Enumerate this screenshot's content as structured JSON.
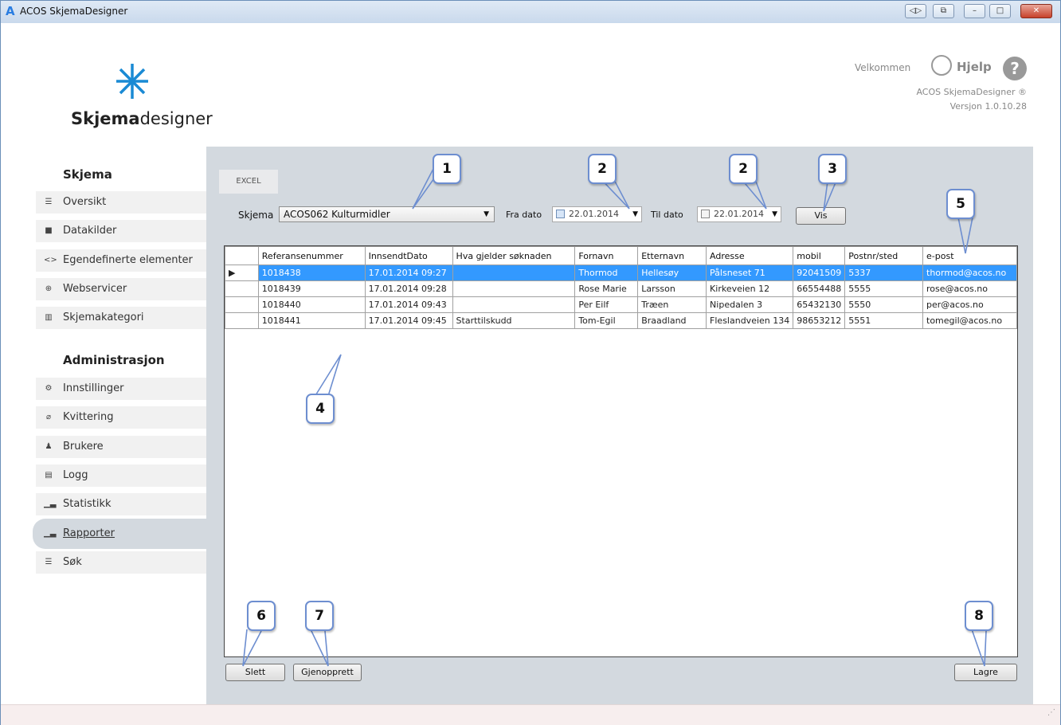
{
  "window": {
    "title": "ACOS SkjemaDesigner",
    "buttons": [
      "◁▷",
      "⧉",
      "–",
      "□",
      "✕"
    ]
  },
  "header": {
    "logo_bold": "Skjema",
    "logo_rest": "designer",
    "welcome": "Velkommen",
    "help": "Hjelp",
    "help_icon": "?",
    "product": "ACOS SkjemaDesigner ®",
    "version": "Versjon 1.0.10.28"
  },
  "sidebar": {
    "section1": "Skjema",
    "section2": "Administrasjon",
    "items": [
      {
        "label": "Oversikt",
        "icon": "list-icon",
        "glyph": "☰"
      },
      {
        "label": "Datakilder",
        "icon": "database-icon",
        "glyph": "■"
      },
      {
        "label": "Egendefinerte elementer",
        "icon": "code-icon",
        "glyph": "<>"
      },
      {
        "label": "Webservicer",
        "icon": "globe-icon",
        "glyph": "⊕"
      },
      {
        "label": "Skjemakategori",
        "icon": "category-icon",
        "glyph": "▥"
      },
      {
        "label": "Innstillinger",
        "icon": "gear-icon",
        "glyph": "⚙"
      },
      {
        "label": "Kvittering",
        "icon": "paperclip-icon",
        "glyph": "⌀"
      },
      {
        "label": "Brukere",
        "icon": "user-icon",
        "glyph": "♟"
      },
      {
        "label": "Logg",
        "icon": "log-icon",
        "glyph": "▤"
      },
      {
        "label": "Statistikk",
        "icon": "stats-icon",
        "glyph": "▁▃"
      },
      {
        "label": "Rapporter",
        "icon": "report-icon",
        "glyph": "▁▃"
      },
      {
        "label": "Søk",
        "icon": "search-list-icon",
        "glyph": "☰"
      }
    ]
  },
  "toolbar": {
    "excel": "EXCEL",
    "schema_label": "Skjema",
    "schema_value": "ACOS062 Kulturmidler",
    "from_label": "Fra dato",
    "from_value": "22.01.2014",
    "to_label": "Til dato",
    "to_value": "22.01.2014",
    "show": "Vis"
  },
  "table": {
    "headers": [
      "Referansenummer",
      "InnsendtDato",
      "Hva gjelder søknaden",
      "Fornavn",
      "Etternavn",
      "Adresse",
      "mobil",
      "Postnr/sted",
      "e-post"
    ],
    "rows": [
      [
        "1018438",
        "17.01.2014 09:27",
        "",
        "Thormod",
        "Hellesøy",
        "Pålsneset 71",
        "92041509",
        "5337",
        "thormod@acos.no"
      ],
      [
        "1018439",
        "17.01.2014 09:28",
        "",
        "Rose Marie",
        "Larsson",
        "Kirkeveien 12",
        "66554488",
        "5555",
        "rose@acos.no"
      ],
      [
        "1018440",
        "17.01.2014 09:43",
        "",
        "Per Eilf",
        "Træen",
        "Nipedalen 3",
        "65432130",
        "5550",
        "per@acos.no"
      ],
      [
        "1018441",
        "17.01.2014 09:45",
        "Starttilskudd",
        "Tom-Egil",
        "Braadland",
        "Fleslandveien 134",
        "98653212",
        "5551",
        "tomegil@acos.no"
      ]
    ],
    "selected_row": 0
  },
  "actions": {
    "delete": "Slett",
    "restore": "Gjenopprett",
    "save": "Lagre"
  },
  "callouts": [
    "1",
    "2",
    "2",
    "3",
    "4",
    "5",
    "6",
    "7",
    "8"
  ],
  "colors": {
    "selection": "#3399ff",
    "content_bg": "#d3d9df",
    "callout_border": "#6d8ed0",
    "logo_blue": "#1a8ad4"
  }
}
